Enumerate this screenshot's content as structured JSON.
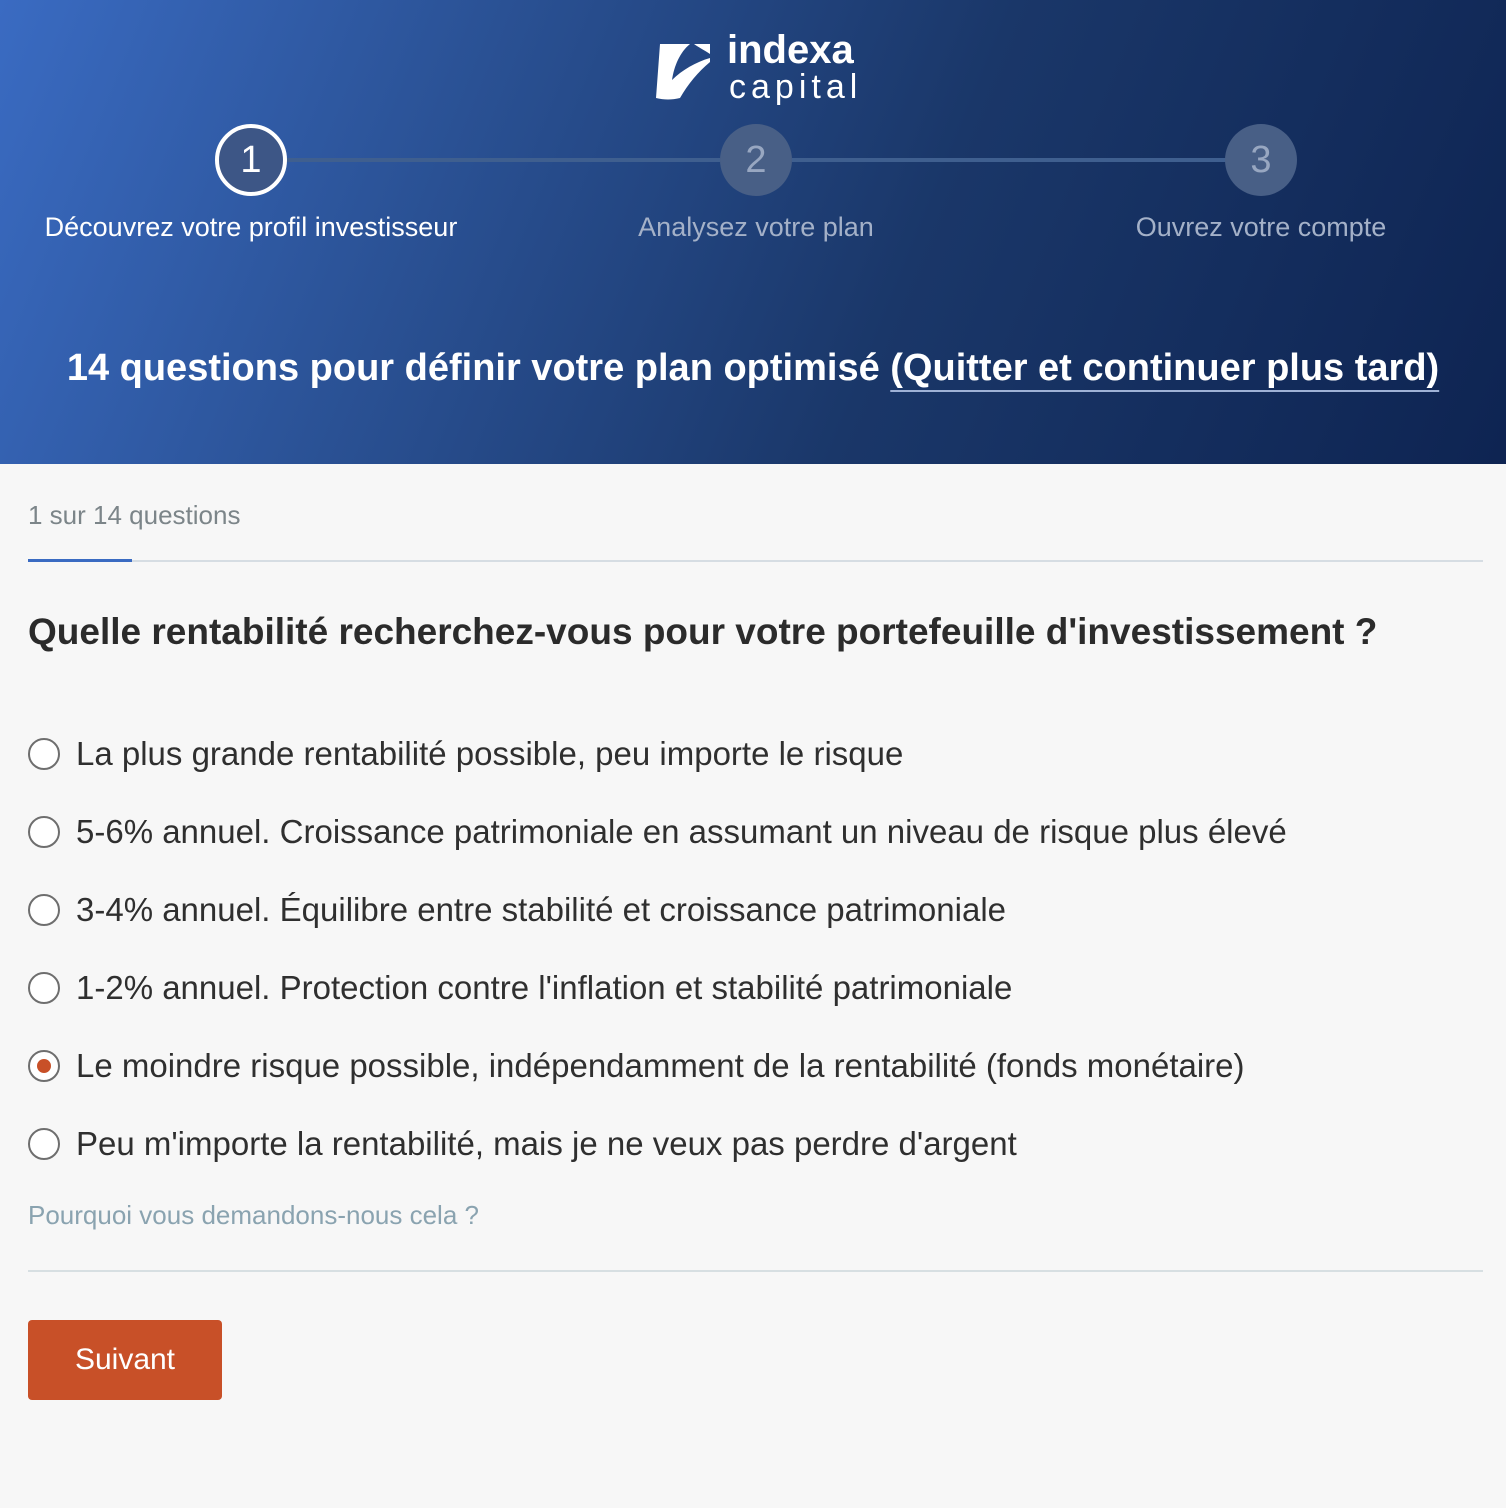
{
  "brand": {
    "name_line1": "indexa",
    "name_line2": "capital"
  },
  "stepper": {
    "steps": [
      {
        "number": "1",
        "label": "Découvrez votre profil investisseur",
        "state": "active"
      },
      {
        "number": "2",
        "label": "Analysez votre plan",
        "state": "inactive"
      },
      {
        "number": "3",
        "label": "Ouvrez votre compte",
        "state": "inactive"
      }
    ]
  },
  "headline": {
    "text": "14 questions pour définir votre plan optimisé ",
    "quit_link": "(Quitter et continuer plus tard)"
  },
  "progress": {
    "counter_text": "1 sur 14 questions",
    "current": 1,
    "total": 14
  },
  "question": {
    "text": "Quelle rentabilité recherchez-vous pour votre portefeuille d'investissement ?",
    "options": [
      {
        "label": "La plus grande rentabilité possible, peu importe le risque",
        "selected": false
      },
      {
        "label": "5-6% annuel. Croissance patrimoniale en assumant un niveau de risque plus élevé",
        "selected": false
      },
      {
        "label": "3-4% annuel. Équilibre entre stabilité et croissance patrimoniale",
        "selected": false
      },
      {
        "label": "1-2% annuel. Protection contre l'inflation et stabilité patrimoniale",
        "selected": false
      },
      {
        "label": "Le moindre risque possible, indépendamment de la rentabilité (fonds monétaire)",
        "selected": true
      },
      {
        "label": "Peu m'importe la rentabilité, mais je ne veux pas perdre d'argent",
        "selected": false
      }
    ],
    "why_link": "Pourquoi vous demandons-nous cela ?"
  },
  "actions": {
    "next_label": "Suivant"
  },
  "colors": {
    "accent": "#c85028",
    "header_start": "#3a6bc2",
    "header_end": "#0e2452",
    "progress": "#3a6bc2"
  }
}
